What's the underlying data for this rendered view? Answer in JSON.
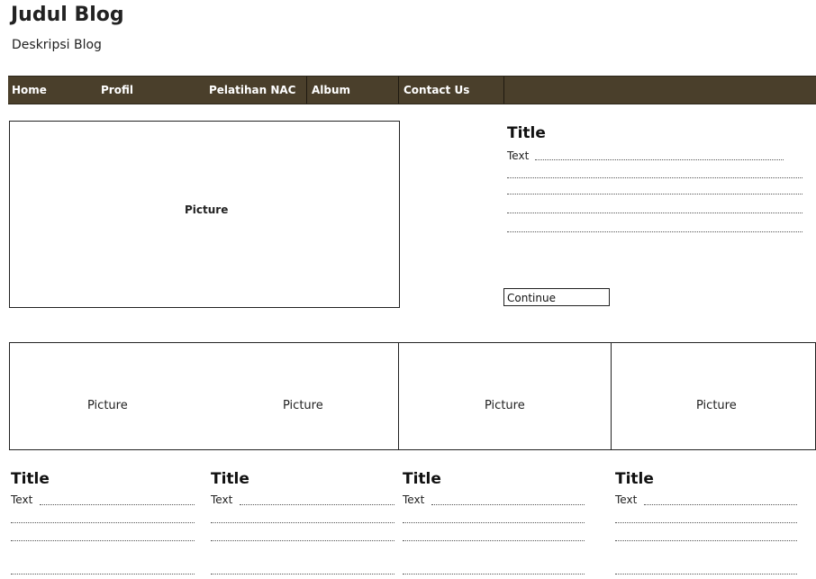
{
  "header": {
    "title": "Judul Blog",
    "description": "Deskripsi Blog"
  },
  "nav": {
    "items": [
      "Home",
      "Profil",
      "Pelatihan NAC",
      "Album",
      "Contact Us"
    ]
  },
  "featured": {
    "picture_label": "Picture",
    "title": "Title",
    "text": "Text",
    "continue_label": "Continue"
  },
  "gallery": {
    "pictures": [
      "Picture",
      "Picture",
      "Picture",
      "Picture"
    ]
  },
  "posts": [
    {
      "title": "Title",
      "text": "Text"
    },
    {
      "title": "Title",
      "text": "Text"
    },
    {
      "title": "Title",
      "text": "Text"
    },
    {
      "title": "Title",
      "text": "Text"
    }
  ],
  "colors": {
    "nav_background": "#4a3f2b",
    "nav_text": "#ffffff"
  }
}
